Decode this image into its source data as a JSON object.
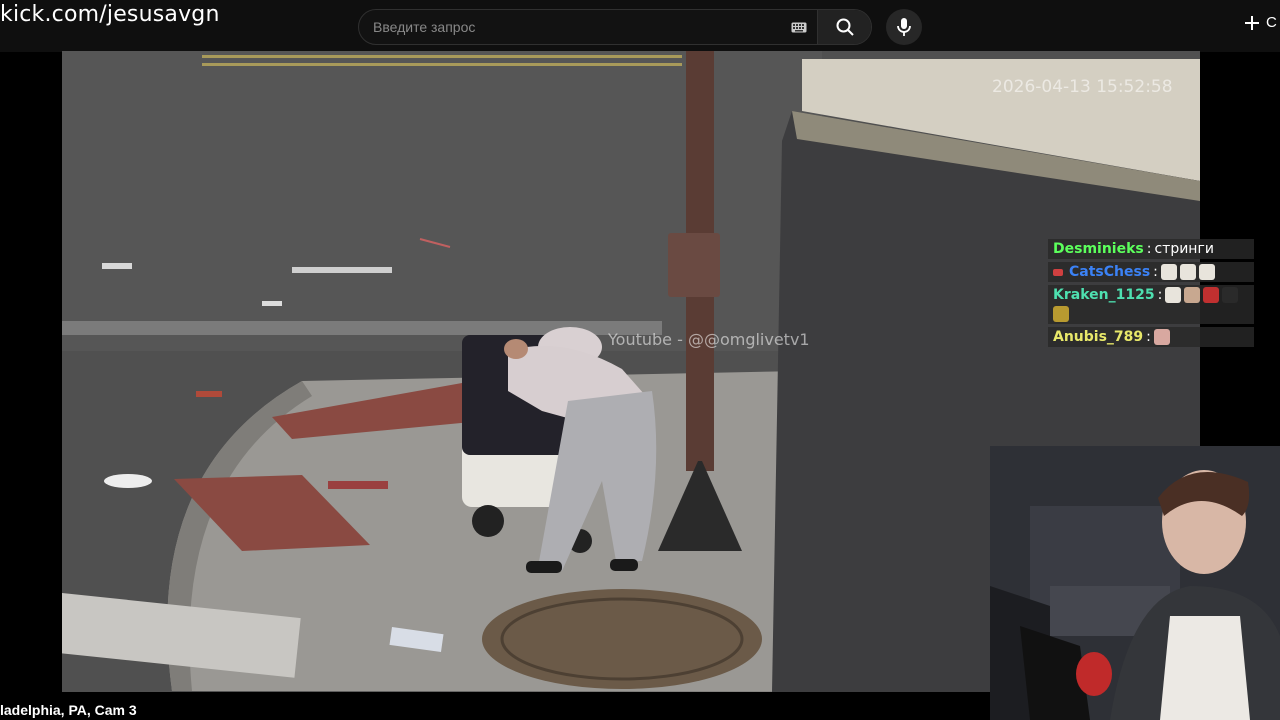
{
  "header": {
    "channel_url": "kick.com/jesusavgn",
    "search_placeholder": "Введите запрос",
    "create_label": "С"
  },
  "icons": {
    "keyboard": "keyboard-icon",
    "search": "search-icon",
    "mic": "mic-icon",
    "plus": "plus-icon"
  },
  "video": {
    "timestamp": "2026-04-13 15:52:58",
    "watermark": "Youtube - @@omglivetv1"
  },
  "chat": {
    "messages": [
      {
        "user": "Desminieks",
        "user_color": "#5cff5c",
        "separator": " : ",
        "text": "стринги",
        "emotes": []
      },
      {
        "user": "CatsChess",
        "user_color": "#3b82f6",
        "separator": " : ",
        "text": "",
        "emotes": [
          "duck",
          "duck",
          "duck"
        ]
      },
      {
        "user": "Kraken_1125",
        "user_color": "#4ee0b0",
        "separator": " : ",
        "text": "",
        "emotes": [
          "duck",
          "face",
          "red-face",
          "dark-face",
          "cat"
        ]
      },
      {
        "user": "Anubis_789",
        "user_color": "#e8e86a",
        "separator": " : ",
        "text": "",
        "emotes": [
          "face"
        ]
      }
    ]
  },
  "footer": {
    "video_title": "ladelphia, PA, Cam 3"
  },
  "colors": {
    "topbar_bg": "#0f0f0f",
    "search_border": "#303030",
    "chat_bg": "rgba(40,40,40,0.82)"
  }
}
